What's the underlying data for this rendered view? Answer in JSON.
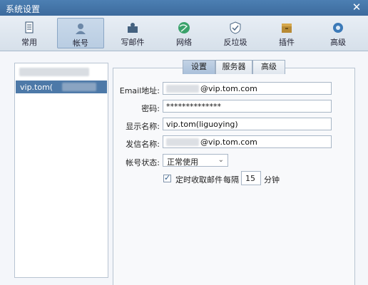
{
  "window": {
    "title": "系统设置",
    "close_glyph": "✕"
  },
  "toolbar": {
    "items": [
      {
        "label": "常用",
        "icon": "document-icon"
      },
      {
        "label": "帐号",
        "icon": "user-icon"
      },
      {
        "label": "写邮件",
        "icon": "compose-icon"
      },
      {
        "label": "网络",
        "icon": "globe-icon"
      },
      {
        "label": "反垃圾",
        "icon": "shield-icon"
      },
      {
        "label": "插件",
        "icon": "plugin-box-icon"
      },
      {
        "label": "高级",
        "icon": "gear-icon"
      }
    ],
    "active_index": 1
  },
  "accounts": {
    "selected_label": "vip.tom("
  },
  "tabs": {
    "items": [
      "设置",
      "服务器",
      "高级"
    ],
    "active_index": 0
  },
  "form": {
    "email_label": "Email地址:",
    "email_value": "@vip.tom.com",
    "password_label": "密码:",
    "password_value": "**************",
    "display_name_label": "显示名称:",
    "display_name_value": "vip.tom(liguoying)",
    "sender_name_label": "发信名称:",
    "sender_name_value": "@vip.tom.com",
    "status_label": "帐号状态:",
    "status_value": "正常使用",
    "status_chevron": "⌄",
    "auto_fetch_checked": true,
    "auto_fetch_label": "定时收取邮件",
    "every_label": "每隔",
    "interval_value": "15",
    "interval_unit": "分钟"
  },
  "colors": {
    "accent": "#4d79a8",
    "titlebar": "#3c6a9d"
  }
}
